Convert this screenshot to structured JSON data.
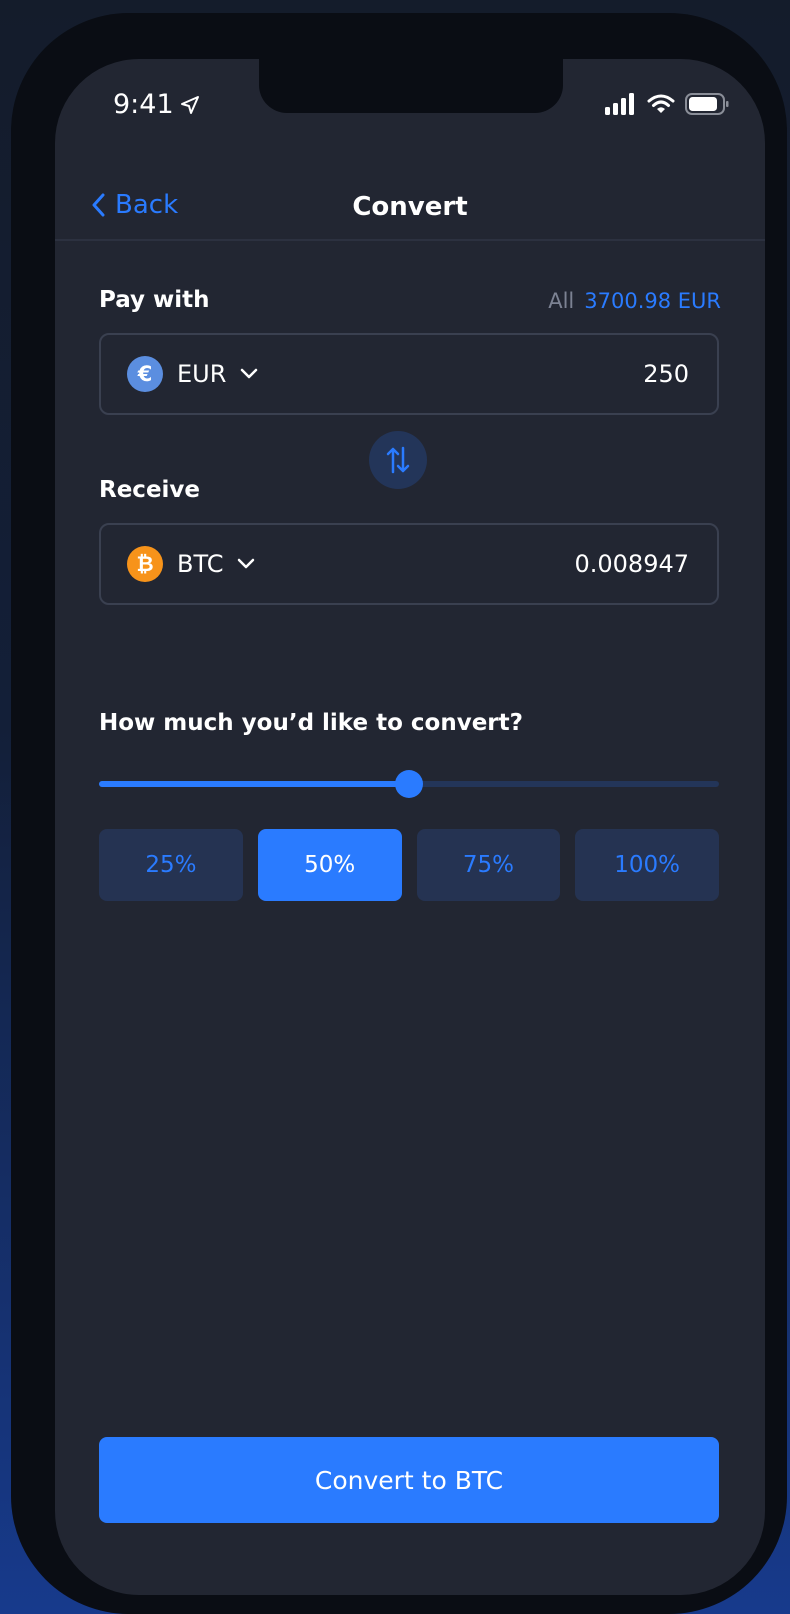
{
  "status_bar": {
    "time": "9:41"
  },
  "nav": {
    "back_label": "Back",
    "title": "Convert"
  },
  "pay_with": {
    "label": "Pay with",
    "all_label": "All",
    "all_value": "3700.98 EUR",
    "currency": "EUR",
    "currency_symbol": "€",
    "amount": "250"
  },
  "receive": {
    "label": "Receive",
    "currency": "BTC",
    "currency_symbol": "₿",
    "amount": "0.008947"
  },
  "slider": {
    "question": "How much you’d like to convert?",
    "value_percent": 50
  },
  "percent_options": [
    {
      "label": "25%",
      "selected": false
    },
    {
      "label": "50%",
      "selected": true
    },
    {
      "label": "75%",
      "selected": false
    },
    {
      "label": "100%",
      "selected": false
    }
  ],
  "convert_button_label": "Convert to BTC",
  "colors": {
    "accent": "#2a7bff",
    "background": "#222632",
    "field_border": "#3a4050",
    "muted_button": "#253352",
    "btc": "#f7931a",
    "eur": "#5b8ee0"
  }
}
